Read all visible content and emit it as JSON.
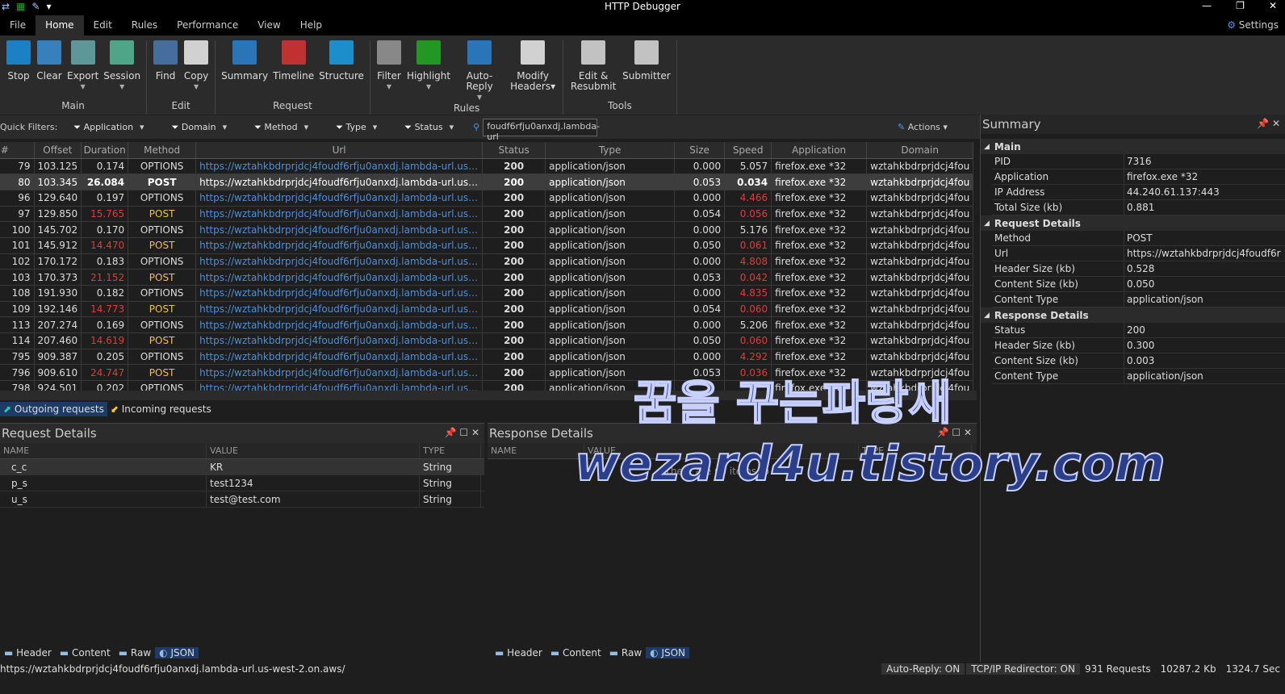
{
  "window": {
    "title": "HTTP Debugger",
    "minimize": "—",
    "restore": "❐",
    "close": "✕"
  },
  "menu": [
    "File",
    "Home",
    "Edit",
    "Rules",
    "Performance",
    "View",
    "Help"
  ],
  "settings_label": "Settings",
  "ribbon": [
    {
      "label": "Main",
      "buttons": [
        {
          "label": "Stop",
          "color": "#1a8fe0"
        },
        {
          "label": "Clear",
          "color": "#3a8fd6"
        },
        {
          "label": "Export",
          "color": "#6aa",
          "dd": true
        },
        {
          "label": "Session",
          "color": "#5b9",
          "dd": true
        }
      ]
    },
    {
      "label": "Edit",
      "buttons": [
        {
          "label": "Find",
          "color": "#4a7ab0"
        },
        {
          "label": "Copy",
          "color": "#eee",
          "dd": true
        }
      ]
    },
    {
      "label": "Request",
      "buttons": [
        {
          "label": "Summary",
          "color": "#2a82d0"
        },
        {
          "label": "Timeline",
          "color": "#d33"
        },
        {
          "label": "Structure",
          "color": "#1aa0e8"
        }
      ]
    },
    {
      "label": "Rules",
      "buttons": [
        {
          "label": "Filter",
          "color": "#999",
          "dd": true
        },
        {
          "label": "Highlight",
          "color": "#2a2",
          "dd": true
        },
        {
          "label": "Auto-Reply",
          "color": "#2a82d0",
          "dd": true
        },
        {
          "label": "Modify Headers▾",
          "color": "#eee"
        }
      ]
    },
    {
      "label": "Tools",
      "buttons": [
        {
          "label": "Edit & Resubmit",
          "color": "#ddd"
        },
        {
          "label": "Submitter",
          "color": "#ddd"
        }
      ]
    }
  ],
  "quick_filters": {
    "label": "Quick Filters:",
    "filters": [
      "Application",
      "Domain",
      "Method",
      "Type",
      "Status"
    ],
    "search_value": "foudf6rfju0anxdj.lambda-url",
    "actions": "Actions"
  },
  "columns": [
    "#",
    "Offset",
    "Duration",
    "Method",
    "Url",
    "Status",
    "Type",
    "Size",
    "Speed",
    "Application",
    "Domain"
  ],
  "url": "https://wztahkbdrprjdcj4foudf6rfju0anxdj.lambda-url.us-west-2....",
  "domain": "wztahkbdrprjdcj4fou",
  "rows": [
    [
      "79",
      "103.125",
      "0.174",
      "OPTIONS",
      "200",
      "application/json",
      "0.000",
      "5.057",
      "firefox.exe *32"
    ],
    [
      "80",
      "103.345",
      "26.084",
      "POST",
      "200",
      "application/json",
      "0.053",
      "0.034",
      "firefox.exe *32"
    ],
    [
      "96",
      "129.640",
      "0.197",
      "OPTIONS",
      "200",
      "application/json",
      "0.000",
      "4.466",
      "firefox.exe *32"
    ],
    [
      "97",
      "129.850",
      "15.765",
      "POST",
      "200",
      "application/json",
      "0.054",
      "0.056",
      "firefox.exe *32"
    ],
    [
      "100",
      "145.702",
      "0.170",
      "OPTIONS",
      "200",
      "application/json",
      "0.000",
      "5.176",
      "firefox.exe *32"
    ],
    [
      "101",
      "145.912",
      "14.470",
      "POST",
      "200",
      "application/json",
      "0.050",
      "0.061",
      "firefox.exe *32"
    ],
    [
      "102",
      "170.172",
      "0.183",
      "OPTIONS",
      "200",
      "application/json",
      "0.000",
      "4.808",
      "firefox.exe *32"
    ],
    [
      "103",
      "170.373",
      "21.152",
      "POST",
      "200",
      "application/json",
      "0.053",
      "0.042",
      "firefox.exe *32"
    ],
    [
      "108",
      "191.930",
      "0.182",
      "OPTIONS",
      "200",
      "application/json",
      "0.000",
      "4.835",
      "firefox.exe *32"
    ],
    [
      "109",
      "192.146",
      "14.773",
      "POST",
      "200",
      "application/json",
      "0.054",
      "0.060",
      "firefox.exe *32"
    ],
    [
      "113",
      "207.274",
      "0.169",
      "OPTIONS",
      "200",
      "application/json",
      "0.000",
      "5.206",
      "firefox.exe *32"
    ],
    [
      "114",
      "207.460",
      "14.619",
      "POST",
      "200",
      "application/json",
      "0.050",
      "0.060",
      "firefox.exe *32"
    ],
    [
      "795",
      "909.387",
      "0.205",
      "OPTIONS",
      "200",
      "application/json",
      "0.000",
      "4.292",
      "firefox.exe *32"
    ],
    [
      "796",
      "909.610",
      "24.747",
      "POST",
      "200",
      "application/json",
      "0.053",
      "0.036",
      "firefox.exe *32"
    ],
    [
      "798",
      "924.501",
      "0.202",
      "OPTIONS",
      "200",
      "application/json",
      "",
      "",
      "firefox.exe *32"
    ]
  ],
  "selected_row": 1,
  "red_speeds": [
    "4.466",
    "0.056",
    "0.061",
    "4.808",
    "0.042",
    "4.835",
    "0.060",
    "4.292",
    "0.036"
  ],
  "direction_tabs": [
    "Outgoing requests",
    "Incoming requests"
  ],
  "request_details": {
    "title": "Request Details",
    "columns": [
      "NAME",
      "VALUE",
      "TYPE"
    ],
    "rows": [
      [
        "c_c",
        "KR",
        "String"
      ],
      [
        "p_s",
        "test1234",
        "String"
      ],
      [
        "u_s",
        "test@test.com",
        "String"
      ]
    ]
  },
  "response_details": {
    "title": "Response Details",
    "columns": [
      "NAME",
      "VALUE",
      "TYPE"
    ],
    "empty": "There are no items to show."
  },
  "bottom_tabs": [
    "Header",
    "Content",
    "Raw",
    "JSON"
  ],
  "summary": {
    "title": "Summary",
    "sections": [
      {
        "name": "Main",
        "rows": [
          [
            "PID",
            "7316"
          ],
          [
            "Application",
            "firefox.exe *32"
          ],
          [
            "IP Address",
            "44.240.61.137:443"
          ],
          [
            "Total Size (kb)",
            "0.881"
          ]
        ]
      },
      {
        "name": "Request Details",
        "rows": [
          [
            "Method",
            "POST"
          ],
          [
            "Url",
            "https://wztahkbdrprjdcj4foudf6r"
          ],
          [
            "Header Size (kb)",
            "0.528"
          ],
          [
            "Content Size (kb)",
            "0.050"
          ],
          [
            "Content Type",
            "application/json"
          ]
        ]
      },
      {
        "name": "Response Details",
        "rows": [
          [
            "Status",
            "200"
          ],
          [
            "Header Size (kb)",
            "0.300"
          ],
          [
            "Content Size (kb)",
            "0.003"
          ],
          [
            "Content Type",
            "application/json"
          ]
        ]
      }
    ]
  },
  "statusbar": {
    "url": "https://wztahkbdrprjdcj4foudf6rfju0anxdj.lambda-url.us-west-2.on.aws/",
    "auto_reply": "Auto-Reply: ON",
    "redirector": "TCP/IP Redirector: ON",
    "requests": "931 Requests",
    "size": "10287.2 Kb",
    "time": "1324.7 Sec"
  },
  "watermark": {
    "line1": "꿈을 꾸는파랑새",
    "line2": "wezard4u.tistory.com"
  },
  "colors": {
    "url": "#4f8fd6",
    "slow": "#e23b3b",
    "post": "#f0c050",
    "accent": "#1c3a6a"
  }
}
